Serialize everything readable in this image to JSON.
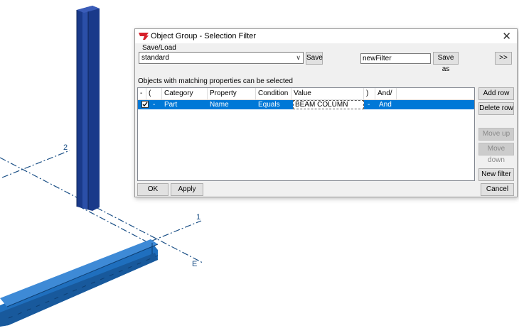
{
  "viewport": {
    "grid_labels": [
      "2",
      "1",
      "E"
    ]
  },
  "dialog": {
    "title": "Object Group - Selection Filter",
    "close_glyph": "✕",
    "save_load_label": "Save/Load",
    "preset_value": "standard",
    "dropdown_glyph": "∨",
    "save_button": "Save",
    "filter_name": "newFilter",
    "save_as_button": "Save as",
    "expand_button": ">>",
    "info_text": "Objects with matching properties can be selected",
    "columns": [
      "-",
      "(",
      "Category",
      "Property",
      "Condition",
      "Value",
      ")",
      "And/"
    ],
    "row": {
      "checked": true,
      "dash": "-",
      "paren_open": "",
      "category": "Part",
      "property": "Name",
      "condition": "Equals",
      "value": "BEAM COLUMN",
      "paren_close": "-",
      "andor": "And"
    },
    "side_buttons": {
      "add_row": "Add row",
      "delete_row": "Delete row",
      "move_up": "Move up",
      "move_down": "Move down",
      "new_filter": "New filter"
    },
    "footer": {
      "ok": "OK",
      "apply": "Apply",
      "cancel": "Cancel"
    }
  },
  "colors": {
    "column_blue": "#1a3a8a",
    "beam_blue": "#1f6fbe",
    "grid_line": "#1a4f86",
    "selection": "#0078d7"
  }
}
